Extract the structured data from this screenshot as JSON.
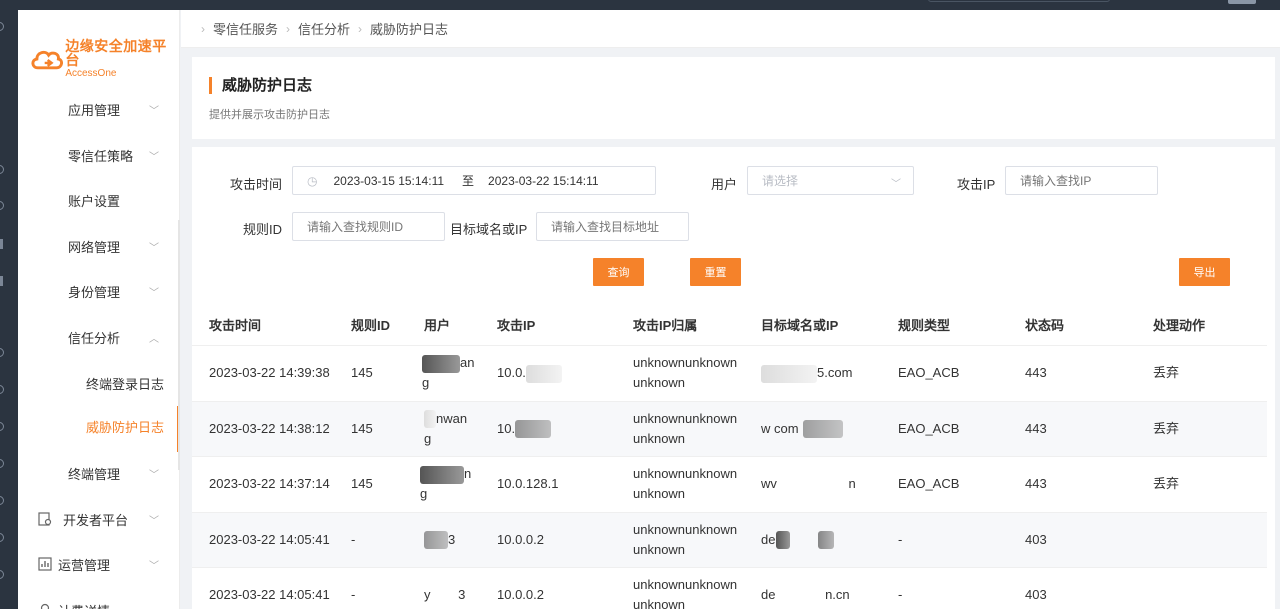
{
  "app": {
    "logo_cn": "边缘安全加速平台",
    "logo_en": "AccessOne",
    "accent": "#f5822a"
  },
  "sidebar": {
    "items": [
      {
        "label": "应用管理",
        "chevron": "down"
      },
      {
        "label": "零信任策略",
        "chevron": "down"
      },
      {
        "label": "账户设置",
        "chevron": ""
      },
      {
        "label": "网络管理",
        "chevron": "down"
      },
      {
        "label": "身份管理",
        "chevron": "down"
      },
      {
        "label": "信任分析",
        "chevron": "up"
      },
      {
        "label": "终端登录日志",
        "sub": true
      },
      {
        "label": "威胁防护日志",
        "sub": true,
        "active": true
      },
      {
        "label": "终端管理",
        "chevron": "down"
      },
      {
        "label": "开发者平台",
        "chevron": "down",
        "icon": "report-icon"
      },
      {
        "label": "运营管理",
        "chevron": "down",
        "icon": "chart-icon"
      },
      {
        "label": "计费详情",
        "icon": "billing-icon"
      }
    ]
  },
  "breadcrumb": [
    "零信任服务",
    "信任分析",
    "威胁防护日志"
  ],
  "header": {
    "title": "威胁防护日志",
    "description": "提供并展示攻击防护日志"
  },
  "filters": {
    "time_label": "攻击时间",
    "time_start": "2023-03-15 15:14:11",
    "time_to": "至",
    "time_end": "2023-03-22 15:14:11",
    "user_label": "用户",
    "user_placeholder": "请选择",
    "ip_label": "攻击IP",
    "ip_placeholder": "请输入查找IP",
    "rule_label": "规则ID",
    "rule_placeholder": "请输入查找规则ID",
    "target_label": "目标域名或IP",
    "target_placeholder": "请输入查找目标地址",
    "query_button": "查询",
    "reset_button": "重置",
    "export_button": "导出"
  },
  "table": {
    "columns": [
      "攻击时间",
      "规则ID",
      "用户",
      "攻击IP",
      "攻击IP归属",
      "目标域名或IP",
      "规则类型",
      "状态码",
      "处理动作"
    ],
    "rows": [
      {
        "time": "2023-03-22 14:39:38",
        "rule": "145",
        "user_a": "an",
        "user_b": "g",
        "ip": "10.0.",
        "geo_a": "unknownunknown",
        "geo_b": "unknown",
        "target": "5.com",
        "type": "EAO_ACB",
        "status": "443",
        "action": "丢弃"
      },
      {
        "time": "2023-03-22 14:38:12",
        "rule": "145",
        "user_a": "nwan",
        "user_b": "g",
        "ip": "10.",
        "geo_a": "unknownunknown",
        "geo_b": "unknown",
        "target": "w com",
        "type": "EAO_ACB",
        "status": "443",
        "action": "丢弃"
      },
      {
        "time": "2023-03-22 14:37:14",
        "rule": "145",
        "user_a": "n",
        "user_b": "g",
        "ip": "10.0.128.1",
        "geo_a": "unknownunknown",
        "geo_b": "unknown",
        "target": "wv n",
        "type": "EAO_ACB",
        "status": "443",
        "action": "丢弃"
      },
      {
        "time": "2023-03-22 14:05:41",
        "rule": "-",
        "user_a": "3",
        "user_b": "",
        "ip": "10.0.0.2",
        "geo_a": "unknownunknown",
        "geo_b": "unknown",
        "target": "de",
        "type": "-",
        "status": "403",
        "action": ""
      },
      {
        "time": "2023-03-22 14:05:41",
        "rule": "-",
        "user_a": "y 3",
        "user_b": "",
        "ip": "10.0.0.2",
        "geo_a": "unknownunknown",
        "geo_b": "unknown",
        "target": "de n.cn",
        "type": "-",
        "status": "403",
        "action": ""
      }
    ]
  }
}
